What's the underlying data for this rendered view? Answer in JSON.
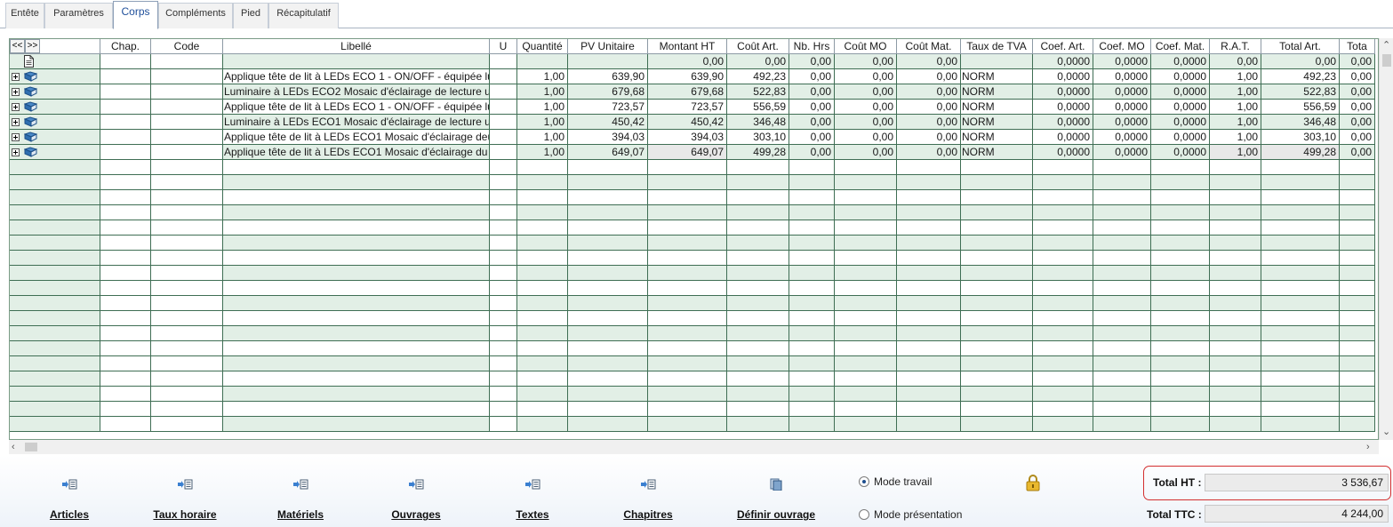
{
  "tabs": [
    {
      "label": "Entête",
      "active": false
    },
    {
      "label": "Paramètres",
      "active": false
    },
    {
      "label": "Corps",
      "active": true
    },
    {
      "label": "Compléments",
      "active": false
    },
    {
      "label": "Pied",
      "active": false
    },
    {
      "label": "Récapitulatif",
      "active": false
    }
  ],
  "grid": {
    "nav_prev": "<<",
    "nav_next": ">>",
    "columns": [
      "",
      "Chap.",
      "Code",
      "Libellé",
      "U",
      "Quantité",
      "PV Unitaire",
      "Montant HT",
      "Coût Art.",
      "Nb. Hrs",
      "Coût MO",
      "Coût Mat.",
      "Taux de TVA",
      "Coef. Art.",
      "Coef. MO",
      "Coef. Mat.",
      "R.A.T.",
      "Total Art.",
      "Tota"
    ],
    "header_row": [
      "",
      "",
      "",
      "",
      "",
      "",
      "",
      "0,00",
      "0,00",
      "0,00",
      "0,00",
      "0,00",
      "",
      "0,0000",
      "0,0000",
      "0,0000",
      "0,00",
      "0,00",
      "0,00"
    ],
    "rows": [
      [
        "",
        "",
        "",
        "Applique tête de lit à LEDs ECO 1 - ON/OFF - équipée lu",
        "",
        "1,00",
        "639,90",
        "639,90",
        "492,23",
        "0,00",
        "0,00",
        "0,00",
        "NORM",
        "0,0000",
        "0,0000",
        "0,0000",
        "1,00",
        "492,23",
        "0,00"
      ],
      [
        "",
        "",
        "",
        "Luminaire à LEDs ECO2 Mosaic d'éclairage de lecture u",
        "",
        "1,00",
        "679,68",
        "679,68",
        "522,83",
        "0,00",
        "0,00",
        "0,00",
        "NORM",
        "0,0000",
        "0,0000",
        "0,0000",
        "1,00",
        "522,83",
        "0,00"
      ],
      [
        "",
        "",
        "",
        "Applique tête de lit à LEDs ECO 1 - ON/OFF - équipée lu",
        "",
        "1,00",
        "723,57",
        "723,57",
        "556,59",
        "0,00",
        "0,00",
        "0,00",
        "NORM",
        "0,0000",
        "0,0000",
        "0,0000",
        "1,00",
        "556,59",
        "0,00"
      ],
      [
        "",
        "",
        "",
        "Luminaire à LEDs ECO1 Mosaic d'éclairage de lecture u",
        "",
        "1,00",
        "450,42",
        "450,42",
        "346,48",
        "0,00",
        "0,00",
        "0,00",
        "NORM",
        "0,0000",
        "0,0000",
        "0,0000",
        "1,00",
        "346,48",
        "0,00"
      ],
      [
        "",
        "",
        "",
        "Applique tête de lit à LEDs ECO1 Mosaic d'éclairage deu",
        "",
        "1,00",
        "394,03",
        "394,03",
        "303,10",
        "0,00",
        "0,00",
        "0,00",
        "NORM",
        "0,0000",
        "0,0000",
        "0,0000",
        "1,00",
        "303,10",
        "0,00"
      ],
      [
        "",
        "",
        "",
        "Applique tête de lit à LEDs ECO1 Mosaic d'éclairage du",
        "",
        "1,00",
        "649,07",
        "649,07",
        "499,28",
        "0,00",
        "0,00",
        "0,00",
        "NORM",
        "0,0000",
        "0,0000",
        "0,0000",
        "1,00",
        "499,28",
        "0,00"
      ]
    ],
    "empty_rows": 18
  },
  "toolbar": {
    "buttons": [
      "Articles",
      "Taux horaire",
      "Matériels",
      "Ouvrages",
      "Textes",
      "Chapitres",
      "Définir ouvrage"
    ],
    "mode_travail": "Mode travail",
    "mode_presentation": "Mode présentation",
    "selected_mode": "Mode travail"
  },
  "totals": {
    "ht_label": "Total HT :",
    "ht_value": "3 536,67",
    "ttc_label": "Total TTC :",
    "ttc_value": "4 244,00"
  },
  "colors": {
    "grid_line": "#3f6e54",
    "row_alt": "#e2efe6",
    "active_tab_text": "#1f4f9a",
    "highlight_border": "#d32f2f"
  }
}
